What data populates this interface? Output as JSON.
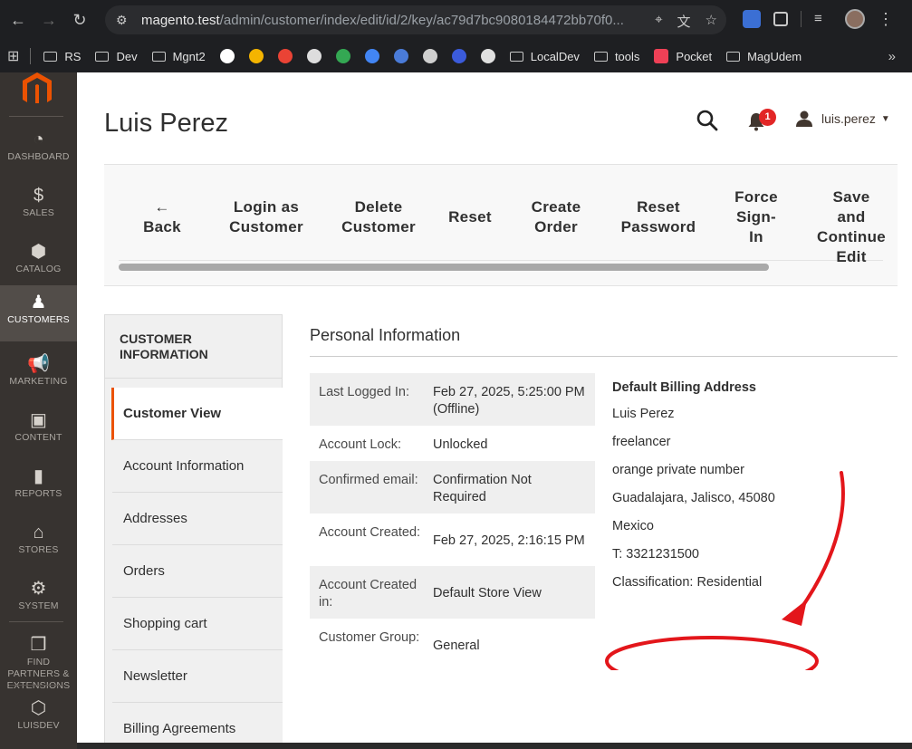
{
  "browser": {
    "url_host": "magento.test",
    "url_path": "/admin/customer/index/edit/id/2/key/ac79d7bc9080184472bb70f0...",
    "bookmarks": [
      {
        "label": "RS",
        "type": "folder"
      },
      {
        "label": "Dev",
        "type": "folder"
      },
      {
        "label": "Mgnt2",
        "type": "folder"
      },
      {
        "label": "",
        "type": "icon",
        "color": "#ffffff"
      },
      {
        "label": "",
        "type": "icon",
        "color": "#f4b400"
      },
      {
        "label": "",
        "type": "icon",
        "color": "#ea4335"
      },
      {
        "label": "",
        "type": "icon",
        "color": "#dddddd"
      },
      {
        "label": "",
        "type": "icon",
        "color": "#34a853"
      },
      {
        "label": "",
        "type": "icon",
        "color": "#4285f4"
      },
      {
        "label": "",
        "type": "icon",
        "color": "#4a7bd8"
      },
      {
        "label": "",
        "type": "icon",
        "color": "#cfcfcf"
      },
      {
        "label": "",
        "type": "icon",
        "color": "#3b5bdb"
      },
      {
        "label": "",
        "type": "icon",
        "color": "#e0e0e0"
      },
      {
        "label": "LocalDev",
        "type": "folder"
      },
      {
        "label": "tools",
        "type": "folder"
      },
      {
        "label": "Pocket",
        "type": "pocket"
      },
      {
        "label": "MagUdem",
        "type": "folder"
      }
    ]
  },
  "admin_nav": {
    "items": [
      {
        "label": "DASHBOARD",
        "icon": "dashboard-icon",
        "glyph": "◔"
      },
      {
        "label": "SALES",
        "icon": "dollar-icon",
        "glyph": "$"
      },
      {
        "label": "CATALOG",
        "icon": "cube-icon",
        "glyph": "⬢"
      },
      {
        "label": "CUSTOMERS",
        "icon": "person-icon",
        "glyph": "♟"
      },
      {
        "label": "MARKETING",
        "icon": "megaphone-icon",
        "glyph": "📢"
      },
      {
        "label": "CONTENT",
        "icon": "layout-icon",
        "glyph": "▣"
      },
      {
        "label": "REPORTS",
        "icon": "bar-chart-icon",
        "glyph": "▮"
      },
      {
        "label": "STORES",
        "icon": "store-icon",
        "glyph": "⌂"
      },
      {
        "label": "SYSTEM",
        "icon": "gear-icon",
        "glyph": "⚙"
      },
      {
        "label": "FIND PARTNERS & EXTENSIONS",
        "icon": "boxes-icon",
        "glyph": "❒"
      },
      {
        "label": "LUISDEV",
        "icon": "hexagon-icon",
        "glyph": "⬡"
      }
    ],
    "active": "CUSTOMERS"
  },
  "header": {
    "title": "Luis Perez",
    "notification_count": "1",
    "username": "luis.perez"
  },
  "actions": [
    {
      "label": "Back",
      "icon": "←"
    },
    {
      "label": "Login as Customer"
    },
    {
      "label": "Delete Customer"
    },
    {
      "label": "Reset"
    },
    {
      "label": "Create Order"
    },
    {
      "label": "Reset Password"
    },
    {
      "label": "Force Sign-In"
    },
    {
      "label": "Save and Continue Edit"
    }
  ],
  "tabs": {
    "heading": "CUSTOMER INFORMATION",
    "items": [
      "Customer View",
      "Account Information",
      "Addresses",
      "Orders",
      "Shopping cart",
      "Newsletter",
      "Billing Agreements"
    ],
    "active": "Customer View"
  },
  "personal_info": {
    "title": "Personal Information",
    "rows": [
      {
        "key": "Last Logged In:",
        "value": "Feb 27, 2025, 5:25:00 PM (Offline)"
      },
      {
        "key": "Account Lock:",
        "value": "Unlocked"
      },
      {
        "key": "Confirmed email:",
        "value": "Confirmation Not Required"
      },
      {
        "key": "Account Created:",
        "value": "Feb 27, 2025, 2:16:15 PM"
      },
      {
        "key": "Account Created in:",
        "value": "Default Store View"
      },
      {
        "key": "Customer Group:",
        "value": "General"
      }
    ]
  },
  "billing": {
    "title": "Default Billing Address",
    "lines": [
      "Luis Perez",
      "freelancer",
      "orange private number",
      "Guadalajara, Jalisco, 45080",
      "Mexico",
      "T: 3321231500",
      "Classification: Residential"
    ]
  },
  "colors": {
    "accent": "#eb5202",
    "annotation": "#e3161b",
    "nav_bg": "#373330"
  }
}
